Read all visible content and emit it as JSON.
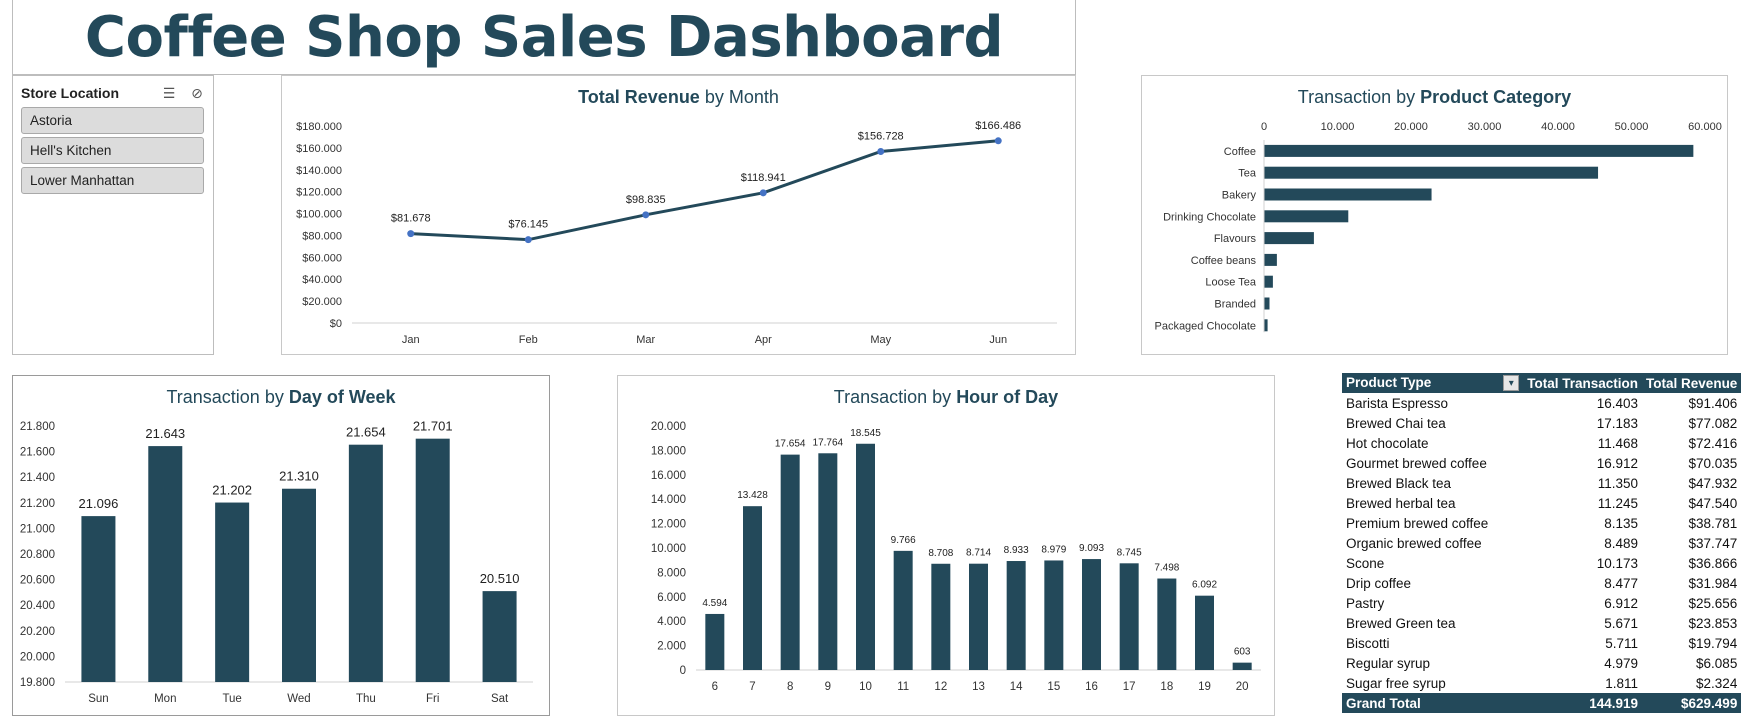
{
  "dashboard": {
    "title": "Coffee Shop Sales Dashboard"
  },
  "slicer": {
    "title": "Store Location",
    "items": [
      "Astoria",
      "Hell's Kitchen",
      "Lower Manhattan"
    ]
  },
  "colors": {
    "primary": "#23495a",
    "marker": "#4472c4",
    "slicer_item_bg": "#dcdcdc"
  },
  "revenue_chart": {
    "title_bold": "Total Revenue",
    "title_rest": " by Month",
    "chart_data": {
      "type": "line",
      "categories": [
        "Jan",
        "Feb",
        "Mar",
        "Apr",
        "May",
        "Jun"
      ],
      "values": [
        81678,
        76145,
        98835,
        118941,
        156728,
        166486
      ],
      "data_labels": [
        "$81.678",
        "$76.145",
        "$98.835",
        "$118.941",
        "$156.728",
        "$166.486"
      ],
      "y_ticks": [
        "$0",
        "$20.000",
        "$40.000",
        "$60.000",
        "$80.000",
        "$100.000",
        "$120.000",
        "$140.000",
        "$160.000",
        "$180.000"
      ],
      "ylim": [
        0,
        180000
      ]
    }
  },
  "category_chart": {
    "title_plain": "Transaction by ",
    "title_bold": "Product Category",
    "chart_data": {
      "type": "bar",
      "orientation": "horizontal",
      "categories": [
        "Coffee",
        "Tea",
        "Bakery",
        "Drinking Chocolate",
        "Flavours",
        "Coffee beans",
        "Loose Tea",
        "Branded",
        "Packaged Chocolate"
      ],
      "values": [
        58416,
        45449,
        22796,
        11468,
        6790,
        1753,
        1210,
        747,
        487
      ],
      "x_ticks": [
        "0",
        "10.000",
        "20.000",
        "30.000",
        "40.000",
        "50.000",
        "60.000"
      ],
      "xlim": [
        0,
        60000
      ]
    }
  },
  "dow_chart": {
    "title_plain": "Transaction by ",
    "title_bold": "Day of Week",
    "chart_data": {
      "type": "bar",
      "categories": [
        "Sun",
        "Mon",
        "Tue",
        "Wed",
        "Thu",
        "Fri",
        "Sat"
      ],
      "values": [
        21096,
        21643,
        21202,
        21310,
        21654,
        21701,
        20510
      ],
      "data_labels": [
        "21.096",
        "21.643",
        "21.202",
        "21.310",
        "21.654",
        "21.701",
        "20.510"
      ],
      "y_ticks": [
        "19.800",
        "20.000",
        "20.200",
        "20.400",
        "20.600",
        "20.800",
        "21.000",
        "21.200",
        "21.400",
        "21.600",
        "21.800"
      ],
      "ylim": [
        19800,
        21800
      ]
    }
  },
  "hour_chart": {
    "title_plain": "Transaction by ",
    "title_bold": "Hour of Day",
    "chart_data": {
      "type": "bar",
      "categories": [
        "6",
        "7",
        "8",
        "9",
        "10",
        "11",
        "12",
        "13",
        "14",
        "15",
        "16",
        "17",
        "18",
        "19",
        "20"
      ],
      "values": [
        4594,
        13428,
        17654,
        17764,
        18545,
        9766,
        8708,
        8714,
        8933,
        8979,
        9093,
        8745,
        7498,
        6092,
        603
      ],
      "data_labels": [
        "4.594",
        "13.428",
        "17.654",
        "17.764",
        "18.545",
        "9.766",
        "8.708",
        "8.714",
        "8.933",
        "8.979",
        "9.093",
        "8.745",
        "7.498",
        "6.092",
        "603"
      ],
      "y_ticks": [
        "0",
        "2.000",
        "4.000",
        "6.000",
        "8.000",
        "10.000",
        "12.000",
        "14.000",
        "16.000",
        "18.000",
        "20.000"
      ],
      "ylim": [
        0,
        20000
      ]
    }
  },
  "pivot": {
    "headers": [
      "Product Type",
      "Total Transaction",
      "Total Revenue"
    ],
    "rows": [
      [
        "Barista Espresso",
        "16.403",
        "$91.406"
      ],
      [
        "Brewed Chai tea",
        "17.183",
        "$77.082"
      ],
      [
        "Hot chocolate",
        "11.468",
        "$72.416"
      ],
      [
        "Gourmet brewed coffee",
        "16.912",
        "$70.035"
      ],
      [
        "Brewed Black tea",
        "11.350",
        "$47.932"
      ],
      [
        "Brewed herbal tea",
        "11.245",
        "$47.540"
      ],
      [
        "Premium brewed coffee",
        "8.135",
        "$38.781"
      ],
      [
        "Organic brewed coffee",
        "8.489",
        "$37.747"
      ],
      [
        "Scone",
        "10.173",
        "$36.866"
      ],
      [
        "Drip coffee",
        "8.477",
        "$31.984"
      ],
      [
        "Pastry",
        "6.912",
        "$25.656"
      ],
      [
        "Brewed Green tea",
        "5.671",
        "$23.853"
      ],
      [
        "Biscotti",
        "5.711",
        "$19.794"
      ],
      [
        "Regular syrup",
        "4.979",
        "$6.085"
      ],
      [
        "Sugar free syrup",
        "1.811",
        "$2.324"
      ]
    ],
    "total": [
      "Grand Total",
      "144.919",
      "$629.499"
    ]
  }
}
